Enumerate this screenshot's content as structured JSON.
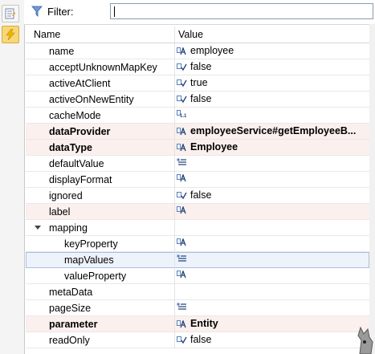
{
  "filter": {
    "label": "Filter:",
    "value": ""
  },
  "table": {
    "headers": {
      "name": "Name",
      "value": "Value"
    },
    "rows": [
      {
        "name": "name",
        "value": "employee",
        "icon": "text-icon",
        "indent": 1,
        "bold": false,
        "highlight": false,
        "selected": false
      },
      {
        "name": "acceptUnknownMapKey",
        "value": "false",
        "icon": "boolean-icon",
        "indent": 1,
        "bold": false,
        "highlight": false,
        "selected": false
      },
      {
        "name": "activeAtClient",
        "value": "true",
        "icon": "boolean-icon",
        "indent": 1,
        "bold": false,
        "highlight": false,
        "selected": false
      },
      {
        "name": "activeOnNewEntity",
        "value": "false",
        "icon": "boolean-icon",
        "indent": 1,
        "bold": false,
        "highlight": false,
        "selected": false
      },
      {
        "name": "cacheMode",
        "value": "",
        "icon": "number-icon",
        "indent": 1,
        "bold": false,
        "highlight": false,
        "selected": false
      },
      {
        "name": "dataProvider",
        "value": "employeeService#getEmployeeB...",
        "icon": "text-icon",
        "indent": 1,
        "bold": true,
        "highlight": true,
        "selected": false
      },
      {
        "name": "dataType",
        "value": "Employee",
        "icon": "text-icon",
        "indent": 1,
        "bold": true,
        "highlight": true,
        "selected": false
      },
      {
        "name": "defaultValue",
        "value": "",
        "icon": "list-icon",
        "indent": 1,
        "bold": false,
        "highlight": false,
        "selected": false
      },
      {
        "name": "displayFormat",
        "value": "",
        "icon": "text-icon",
        "indent": 1,
        "bold": false,
        "highlight": false,
        "selected": false
      },
      {
        "name": "ignored",
        "value": "false",
        "icon": "boolean-icon",
        "indent": 1,
        "bold": false,
        "highlight": false,
        "selected": false
      },
      {
        "name": "label",
        "value": "",
        "icon": "text-icon",
        "indent": 1,
        "bold": false,
        "highlight": true,
        "selected": false
      },
      {
        "name": "mapping",
        "value": "",
        "icon": "",
        "indent": 1,
        "bold": false,
        "highlight": false,
        "selected": false,
        "expander": true
      },
      {
        "name": "keyProperty",
        "value": "",
        "icon": "text-icon",
        "indent": 2,
        "bold": false,
        "highlight": false,
        "selected": false
      },
      {
        "name": "mapValues",
        "value": "",
        "icon": "list-icon",
        "indent": 2,
        "bold": false,
        "highlight": false,
        "selected": true
      },
      {
        "name": "valueProperty",
        "value": "",
        "icon": "text-icon",
        "indent": 2,
        "bold": false,
        "highlight": false,
        "selected": false
      },
      {
        "name": "metaData",
        "value": "",
        "icon": "",
        "indent": 1,
        "bold": false,
        "highlight": false,
        "selected": false
      },
      {
        "name": "pageSize",
        "value": "",
        "icon": "list-icon",
        "indent": 1,
        "bold": false,
        "highlight": false,
        "selected": false
      },
      {
        "name": "parameter",
        "value": "Entity",
        "icon": "text-icon",
        "indent": 1,
        "bold": true,
        "highlight": true,
        "selected": false
      },
      {
        "name": "readOnly",
        "value": "false",
        "icon": "boolean-icon",
        "indent": 1,
        "bold": false,
        "highlight": false,
        "selected": false
      }
    ]
  },
  "colors": {
    "highlight": "#fbf0ed",
    "selected": "#eef3fb",
    "accent": "#2f5f9e"
  }
}
